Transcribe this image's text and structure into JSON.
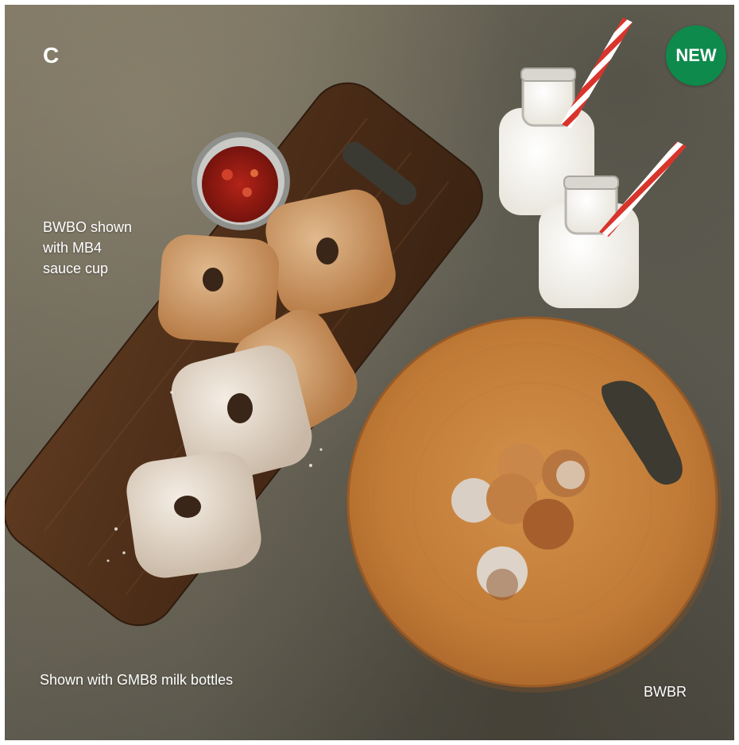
{
  "corner_letter": "C",
  "badge": {
    "text": "NEW",
    "color": "#0e8a4c"
  },
  "captions": {
    "board_note_line1": "BWBO shown",
    "board_note_line2": "with MB4",
    "board_note_line3": "sauce cup",
    "milk_note": "Shown with GMB8 milk bottles",
    "round_board_code": "BWBR"
  }
}
